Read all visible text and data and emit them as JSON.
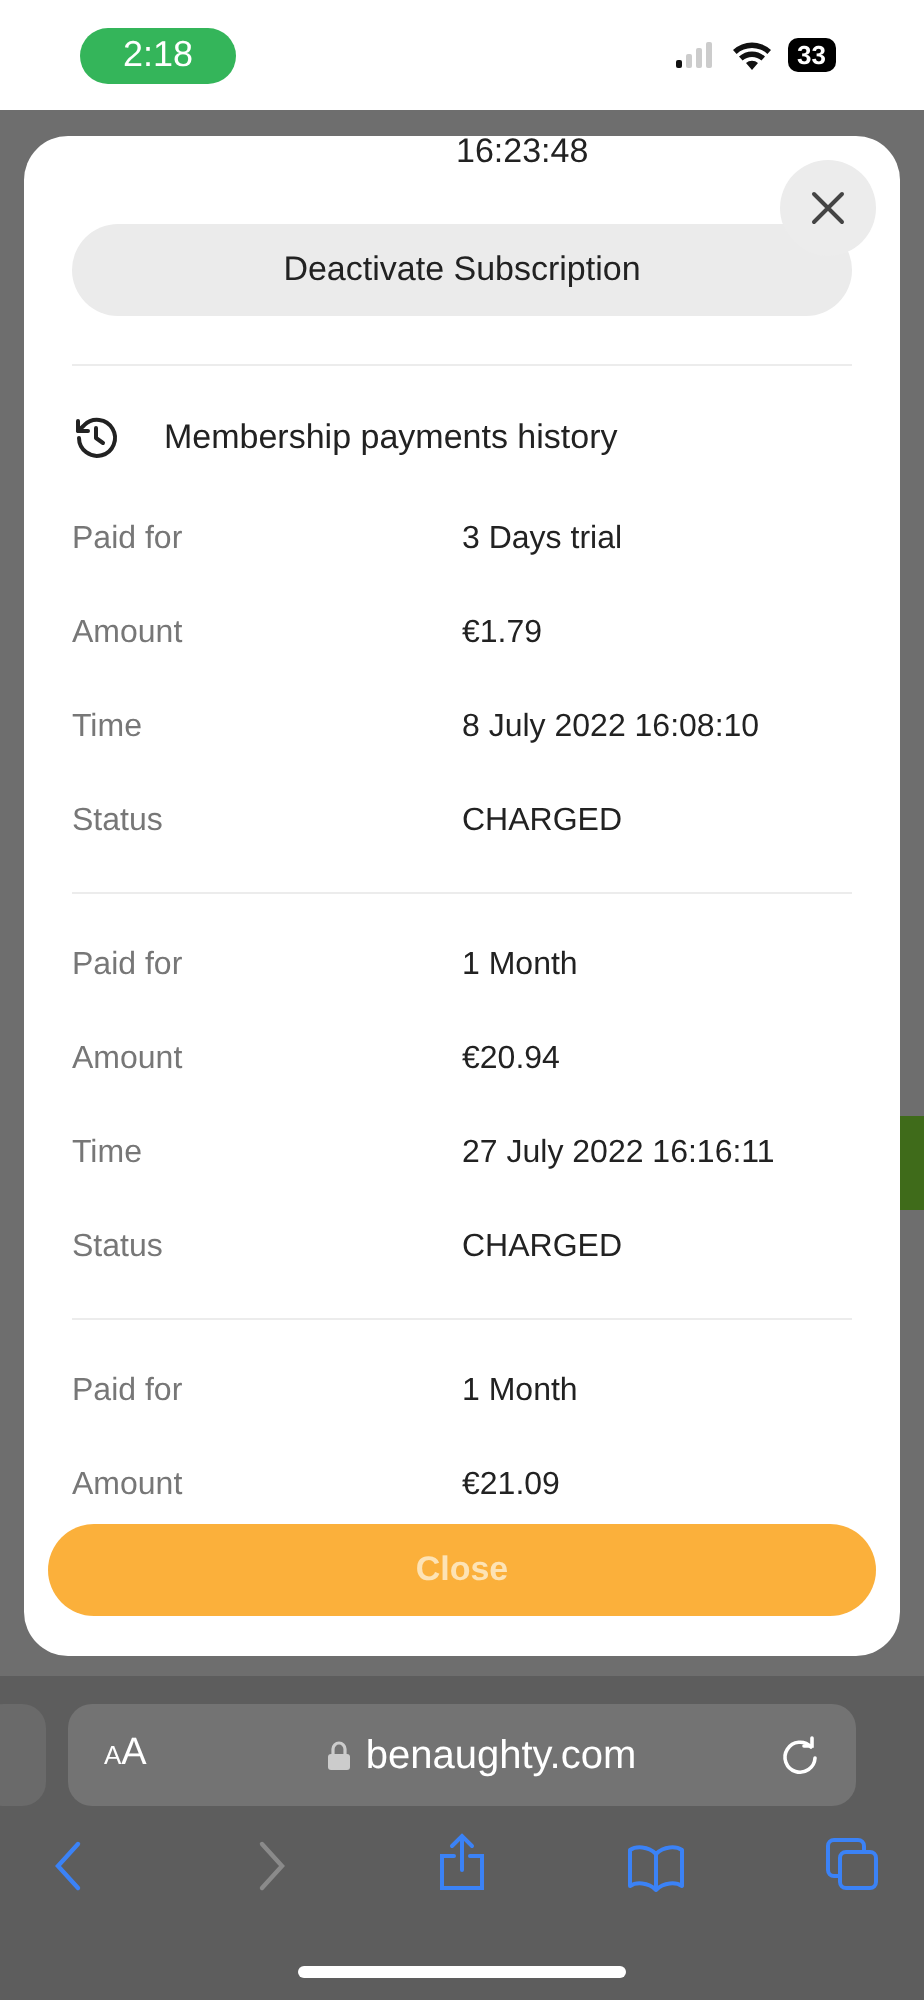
{
  "status_bar": {
    "time": "2:18",
    "battery": "33"
  },
  "modal": {
    "expiration_value": "16:23:48",
    "deactivate_button": "Deactivate Subscription",
    "history_title": "Membership payments history",
    "payments": [
      {
        "rows": [
          {
            "label": "Paid for",
            "value": "3 Days trial"
          },
          {
            "label": "Amount",
            "value": "€1.79"
          },
          {
            "label": "Time",
            "value": "8 July 2022 16:08:10"
          },
          {
            "label": "Status",
            "value": "CHARGED"
          }
        ]
      },
      {
        "rows": [
          {
            "label": "Paid for",
            "value": "1 Month"
          },
          {
            "label": "Amount",
            "value": "€20.94"
          },
          {
            "label": "Time",
            "value": "27 July 2022 16:16:11"
          },
          {
            "label": "Status",
            "value": "CHARGED"
          }
        ]
      },
      {
        "rows": [
          {
            "label": "Paid for",
            "value": "1 Month"
          },
          {
            "label": "Amount",
            "value": "€21.09"
          }
        ]
      }
    ],
    "close_button": "Close"
  },
  "browser": {
    "text_size_button": "AA",
    "url": "benaughty.com"
  }
}
